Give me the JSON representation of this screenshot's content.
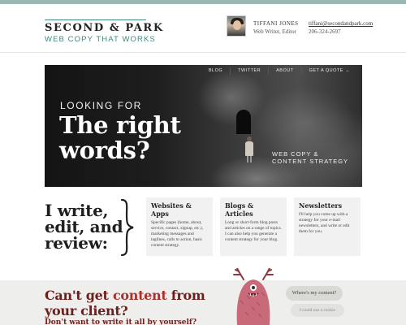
{
  "header": {
    "brand_name": "SECOND & PARK",
    "tagline": "WEB COPY THAT WORKS",
    "person_name": "TIFFANI JONES",
    "person_role": "Web Writer, Editor",
    "email": "tiffani@secondandpark.com",
    "phone": "206-324-2697"
  },
  "hero": {
    "nav": [
      "BLOG",
      "TWITTER",
      "ABOUT",
      "GET A QUOTE →"
    ],
    "kicker": "LOOKING FOR",
    "headline_line1": "The right",
    "headline_line2": "words?",
    "sub_line1": "WEB COPY &",
    "sub_line2": "CONTENT STRATEGY"
  },
  "services": {
    "intro_line1": "I write,",
    "intro_line2": "edit, and",
    "intro_line3": "review:",
    "cards": [
      {
        "title": "Websites & Apps",
        "body": "Specific pages (home, about, service, contact, signup, etc.), marketing messages and taglines, calls to action, basic content strategy."
      },
      {
        "title": "Blogs & Articles",
        "body": "Long or short-form blog posts and articles on a range of topics. I can also help you generate a content strategy for your blog."
      },
      {
        "title": "Newsletters",
        "body": "I'll help you come up with a strategy for your e-mail newsletters, and write or edit them for you."
      }
    ]
  },
  "cta": {
    "line1_a": "Can't get",
    "line1_b": "content",
    "line1_c": "from",
    "line2": "your client?",
    "line3": "Don't want to write it all by yourself?",
    "bubble1": "Where's my content?",
    "bubble2": "I could use a cookie"
  },
  "colors": {
    "accent_teal": "#3e8882",
    "cta_red": "#6c1f1c",
    "monster_pink": "#c86a79"
  }
}
